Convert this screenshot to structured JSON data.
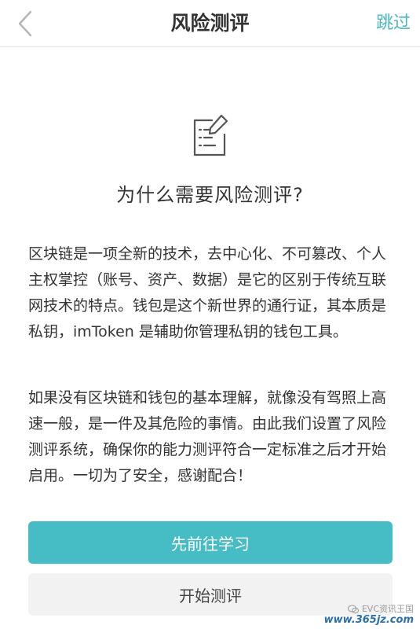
{
  "navbar": {
    "title": "风险测评",
    "skip_label": "跳过",
    "back_icon": "chevron-left-icon"
  },
  "content": {
    "icon": "document-edit-icon",
    "heading": "为什么需要风险测评?",
    "paragraph1": "区块链是一项全新的技术，去中心化、不可篡改、个人主权掌控（账号、资产、数据）是它的区别于传统互联网技术的特点。钱包是这个新世界的通行证，其本质是私钥，imToken 是辅助你管理私钥的钱包工具。",
    "paragraph2": "如果没有区块链和钱包的基本理解，就像没有驾照上高速一般，是一件及其危险的事情。由此我们设置了风险测评系统，确保你的能力测评符合一定标准之后才开始启用。一切为了安全，感谢配合！"
  },
  "actions": {
    "learn_label": "先前往学习",
    "start_label": "开始测评"
  },
  "watermark": {
    "line1": "EVC资讯王国",
    "url": "www.365jz.com"
  },
  "colors": {
    "accent": "#46bcc4",
    "skip_text": "#4ab8c1",
    "secondary_bg": "#f2f2f2"
  }
}
